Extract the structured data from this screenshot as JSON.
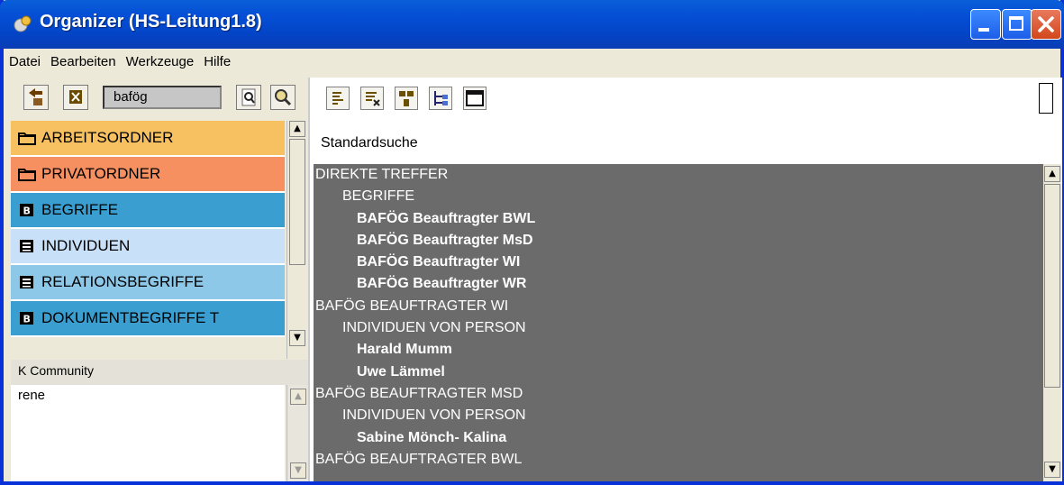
{
  "window": {
    "title": "Organizer (HS-Leitung1.8)"
  },
  "menu": [
    "Datei",
    "Bearbeiten",
    "Werkzeuge",
    "Hilfe"
  ],
  "search": {
    "value": "bafög"
  },
  "folders": [
    {
      "label": "ARBEITSORDNER",
      "color": "#f7c060",
      "icon": "folder-icon"
    },
    {
      "label": "PRIVATORDNER",
      "color": "#f79060",
      "icon": "folder-icon"
    },
    {
      "label": "BEGRIFFE",
      "color": "#3a9fd0",
      "icon": "b-icon"
    },
    {
      "label": "INDIVIDUEN",
      "color": "#c8e0f8",
      "icon": "list-icon"
    },
    {
      "label": "RELATIONSBEGRIFFE",
      "color": "#8ec8e8",
      "icon": "list-icon"
    },
    {
      "label": "DOKUMENTBEGRIFFE T",
      "color": "#3a9fd0",
      "icon": "b-icon"
    }
  ],
  "community": {
    "label": "K Community",
    "items": [
      "rene"
    ]
  },
  "right": {
    "section_title": "Standardsuche"
  },
  "results": [
    {
      "text": "DIREKTE TREFFER",
      "level": 0
    },
    {
      "text": "BEGRIFFE",
      "level": 1
    },
    {
      "text": "BAFÖG Beauftragter BWL",
      "level": 2
    },
    {
      "text": "BAFÖG Beauftragter MsD",
      "level": 2
    },
    {
      "text": "BAFÖG Beauftragter WI",
      "level": 2
    },
    {
      "text": "BAFÖG Beauftragter WR",
      "level": 2
    },
    {
      "text": "BAFÖG BEAUFTRAGTER WI",
      "level": 0
    },
    {
      "text": "INDIVIDUEN VON  PERSON",
      "level": 1
    },
    {
      "text": "Harald Mumm",
      "level": 2
    },
    {
      "text": "Uwe Lämmel",
      "level": 2
    },
    {
      "text": "BAFÖG BEAUFTRAGTER MSD",
      "level": 0
    },
    {
      "text": "INDIVIDUEN VON  PERSON",
      "level": 1
    },
    {
      "text": "Sabine Mönch- Kalina",
      "level": 2
    },
    {
      "text": "BAFÖG BEAUFTRAGTER BWL",
      "level": 0
    }
  ]
}
